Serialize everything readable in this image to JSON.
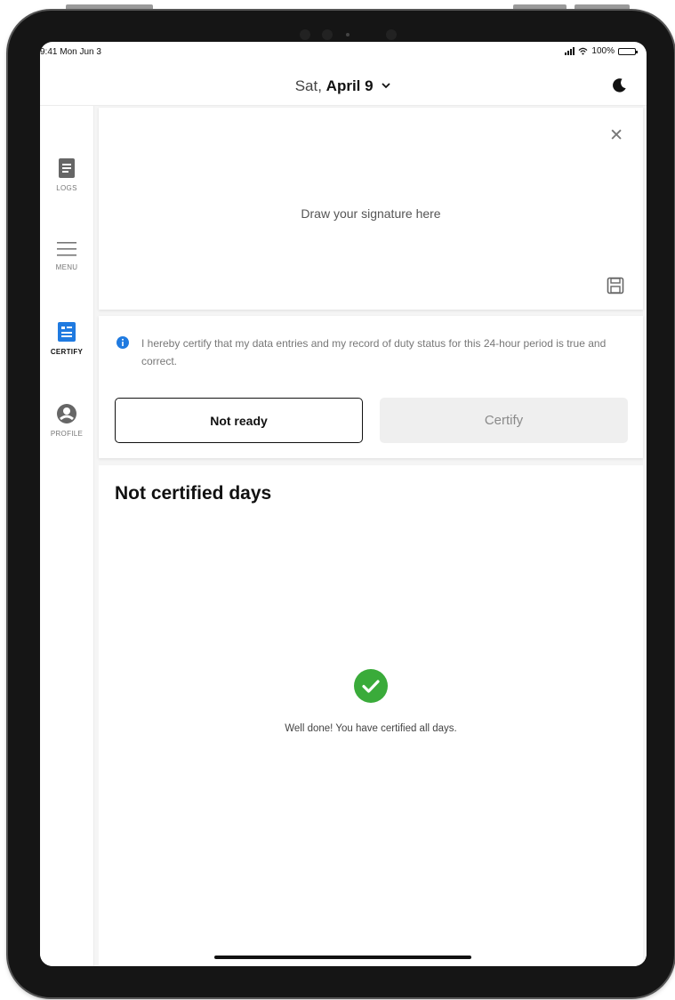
{
  "status_bar": {
    "time": "9:41 Mon Jun 3",
    "battery_text": "100%"
  },
  "header": {
    "date_prefix": "Sat,",
    "date_main": "April 9",
    "chevron": "chevron-down-icon",
    "theme_icon": "moon-icon"
  },
  "sidebar": {
    "items": [
      {
        "label": "LOGS",
        "icon": "document-icon",
        "active": false
      },
      {
        "label": "MENU",
        "icon": "hamburger-icon",
        "active": false
      },
      {
        "label": "CERTIFY",
        "icon": "certify-icon",
        "active": true
      },
      {
        "label": "PROFILE",
        "icon": "user-icon",
        "active": false
      }
    ]
  },
  "signature": {
    "hint": "Draw your signature here",
    "close_icon": "close-icon",
    "save_icon": "save-icon"
  },
  "certification": {
    "statement": "I hereby certify that my data entries and my record of duty status for this 24-hour period is true and correct.",
    "not_ready_label": "Not ready",
    "certify_label": "Certify"
  },
  "not_certified": {
    "title": "Not certified days",
    "empty_message": "Well done! You have certified all days."
  },
  "colors": {
    "accent_blue": "#1f7ae0",
    "success_green": "#3aab3a",
    "text_dark": "#111111",
    "muted": "#8a8a8a"
  }
}
